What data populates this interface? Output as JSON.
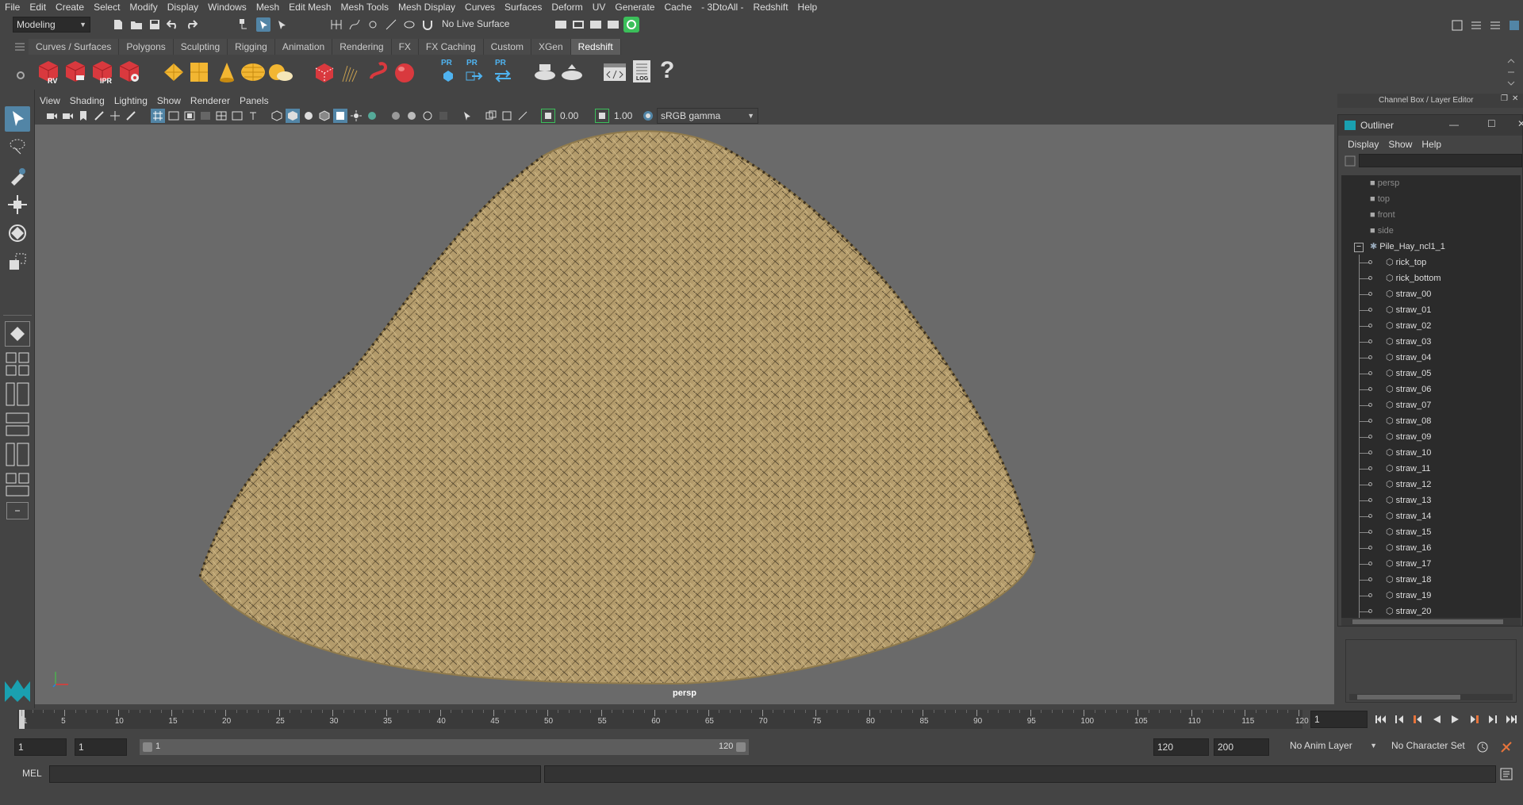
{
  "menubar": [
    "File",
    "Edit",
    "Create",
    "Select",
    "Modify",
    "Display",
    "Windows",
    "Mesh",
    "Edit Mesh",
    "Mesh Tools",
    "Mesh Display",
    "Curves",
    "Surfaces",
    "Deform",
    "UV",
    "Generate",
    "Cache",
    "- 3DtoAll -",
    "Redshift",
    "Help"
  ],
  "status": {
    "mode": "Modeling",
    "live_surface": "No Live Surface"
  },
  "shelf": {
    "tabs": [
      "Curves / Surfaces",
      "Polygons",
      "Sculpting",
      "Rigging",
      "Animation",
      "Rendering",
      "FX",
      "FX Caching",
      "Custom",
      "XGen",
      "Redshift"
    ],
    "active_tab": "Redshift",
    "badge_rv": "RV",
    "badge_ipr": "IPR",
    "pr": "PR",
    "log": "LOG",
    "help": "?"
  },
  "panel": {
    "menu": [
      "View",
      "Shading",
      "Lighting",
      "Show",
      "Renderer",
      "Panels"
    ],
    "exposure": "0.00",
    "gamma": "1.00",
    "color_space": "sRGB gamma",
    "camera_label": "persp"
  },
  "channel_box": {
    "title": "Channel Box / Layer Editor"
  },
  "outliner": {
    "title": "Outliner",
    "menu": [
      "Display",
      "Show",
      "Help"
    ],
    "cameras": [
      "persp",
      "top",
      "front",
      "side"
    ],
    "group": "Pile_Hay_ncl1_1",
    "children": [
      "rick_top",
      "rick_bottom",
      "straw_00",
      "straw_01",
      "straw_02",
      "straw_03",
      "straw_04",
      "straw_05",
      "straw_06",
      "straw_07",
      "straw_08",
      "straw_09",
      "straw_10",
      "straw_11",
      "straw_12",
      "straw_13",
      "straw_14",
      "straw_15",
      "straw_16",
      "straw_17",
      "straw_18",
      "straw_19",
      "straw_20"
    ]
  },
  "timeline": {
    "ticks": [
      "1",
      "5",
      "10",
      "15",
      "20",
      "25",
      "30",
      "35",
      "40",
      "45",
      "50",
      "55",
      "60",
      "65",
      "70",
      "75",
      "80",
      "85",
      "90",
      "95",
      "100",
      "105",
      "110",
      "115",
      "120"
    ],
    "current_frame": "1"
  },
  "range": {
    "start": "1",
    "playback_start": "1",
    "slider_start": "1",
    "slider_end": "120",
    "playback_end": "120",
    "end": "200",
    "anim_layer": "No Anim Layer",
    "char_set": "No Character Set"
  },
  "cmd": {
    "lang": "MEL"
  },
  "colors": {
    "viewport_bg": "#6a6a6a",
    "hay": "#b39b6b",
    "ui_bg": "#444444",
    "accent_green": "#3bbf5a",
    "redshift_red": "#d9393e"
  }
}
